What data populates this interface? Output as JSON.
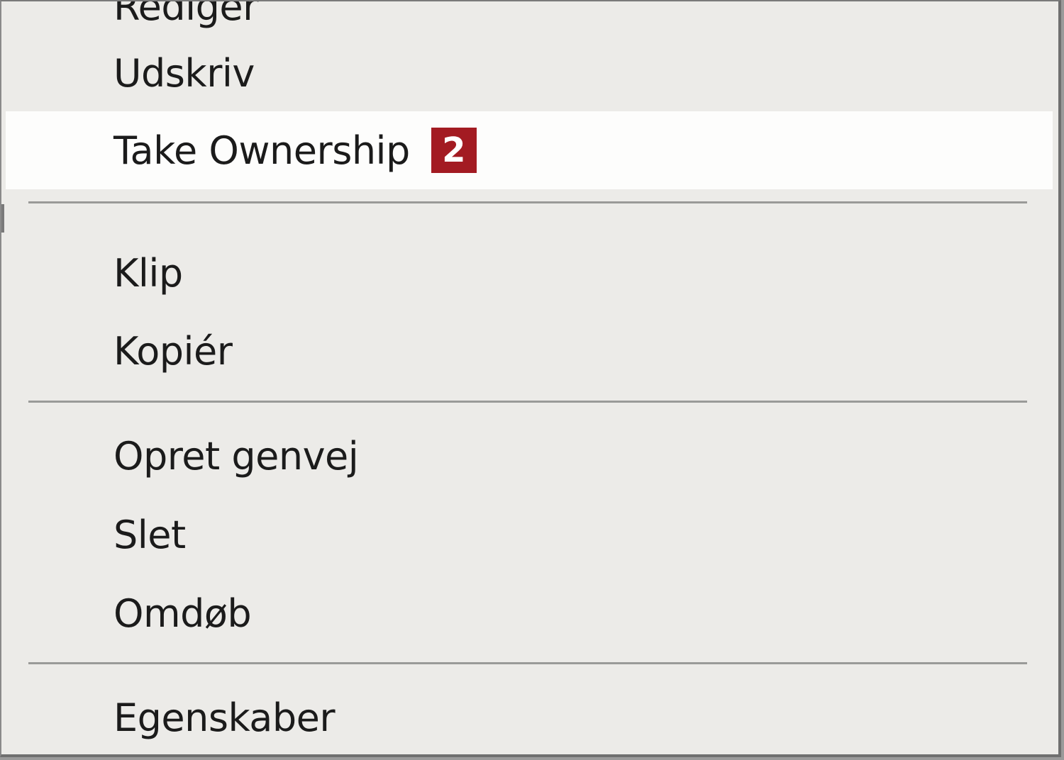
{
  "context_menu": {
    "items": [
      {
        "label": "Rediger"
      },
      {
        "label": "Udskriv"
      },
      {
        "label": "Take Ownership",
        "badge": "2",
        "highlighted": true
      },
      {
        "label": "Klip"
      },
      {
        "label": "Kopiér"
      },
      {
        "label": "Opret genvej"
      },
      {
        "label": "Slet"
      },
      {
        "label": "Omdøb"
      },
      {
        "label": "Egenskaber"
      }
    ],
    "colors": {
      "background": "#ecebe8",
      "highlight": "#fdfdfc",
      "badge": "#a31b22",
      "separator": "#9a9a98"
    }
  }
}
